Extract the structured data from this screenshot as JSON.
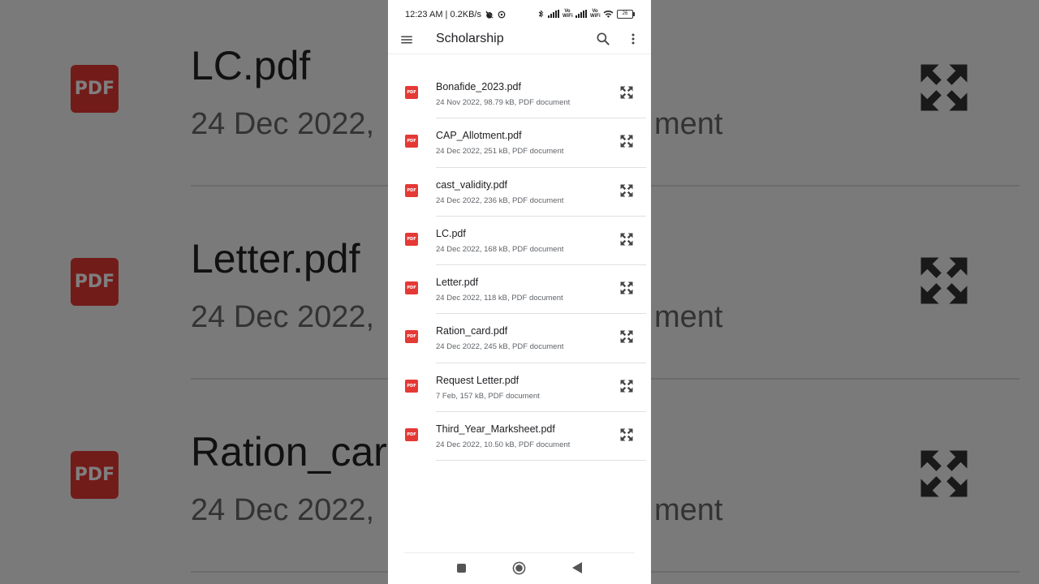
{
  "status_bar": {
    "time_speed": "12:23 AM | 0.2KB/s",
    "battery": "26",
    "volte_label_1": "Vo WiFi",
    "volte_label_2": "Vo WiFi"
  },
  "app_bar": {
    "title": "Scholarship",
    "menu_icon": "hamburger-menu-icon",
    "search_icon": "search-icon",
    "more_icon": "more-vert-icon"
  },
  "files": [
    {
      "name": "Bonafide_2023.pdf",
      "meta": "24 Nov 2022, 98.79 kB, PDF document"
    },
    {
      "name": "CAP_Allotment.pdf",
      "meta": "24 Dec 2022, 251 kB, PDF document"
    },
    {
      "name": "cast_validity.pdf",
      "meta": "24 Dec 2022, 236 kB, PDF document"
    },
    {
      "name": "LC.pdf",
      "meta": "24 Dec 2022, 168 kB, PDF document"
    },
    {
      "name": "Letter.pdf",
      "meta": "24 Dec 2022, 118 kB, PDF document"
    },
    {
      "name": "Ration_card.pdf",
      "meta": "24 Dec 2022, 245 kB, PDF document"
    },
    {
      "name": "Request Letter.pdf",
      "meta": "7 Feb, 157 kB, PDF document"
    },
    {
      "name": "Third_Year_Marksheet.pdf",
      "meta": "24 Dec 2022, 10.50 kB, PDF document"
    }
  ],
  "pdf_badge": "PDF",
  "background": {
    "rows": [
      {
        "title": "LC.pdf",
        "meta_start": "24 Dec 2022, ",
        "meta_tail": "ment"
      },
      {
        "title": "Letter.pdf",
        "meta_start": "24 Dec 2022, ",
        "meta_tail": "ment"
      },
      {
        "title": "Ration_car",
        "meta_start": "24 Dec 2022, ",
        "meta_tail": "ment"
      }
    ]
  },
  "colors": {
    "pdf_red": "#e53935",
    "text_primary": "#202124",
    "text_secondary": "#5f6368"
  }
}
